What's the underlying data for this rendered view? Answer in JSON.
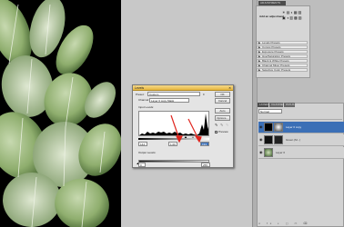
{
  "panels": {
    "adjustments": {
      "tab_label": "ADJUSTMENTS",
      "header": "Add an adjustment",
      "presets": [
        "Levels Presets",
        "Curves Presets",
        "Exposure Presets",
        "Hue/Saturation Presets",
        "Black & White Presets",
        "Channel Mixer Presets",
        "Selective Color Presets"
      ]
    },
    "layers": {
      "tabs": [
        "LAYERS",
        "CHANNELS",
        "PATHS"
      ],
      "blend_mode": "Normal",
      "rows": [
        {
          "name": "Layer 0 copy",
          "selected": true
        },
        {
          "name": "Green (M...)",
          "selected": false
        },
        {
          "name": "Layer 0",
          "selected": false
        }
      ]
    }
  },
  "levels": {
    "title": "Levels",
    "preset_label": "Preset:",
    "preset_value": "Custom",
    "channel_label": "Channel:",
    "channel_value": "Layer 0 copy Mask",
    "input_levels_label": "Input Levels:",
    "input_black": "144",
    "input_gamma": "1.00",
    "input_white": "194",
    "output_levels_label": "Output Levels:",
    "output_black": "0",
    "output_white": "255",
    "buttons": {
      "ok": "OK",
      "cancel": "Cancel",
      "auto": "Auto",
      "options": "Options..."
    },
    "preview_label": "Preview",
    "preview_checked": true
  },
  "colors": {
    "arrow": "#e0251e",
    "title_bar": "#e6b640",
    "selected_layer": "#3b6fb6"
  }
}
